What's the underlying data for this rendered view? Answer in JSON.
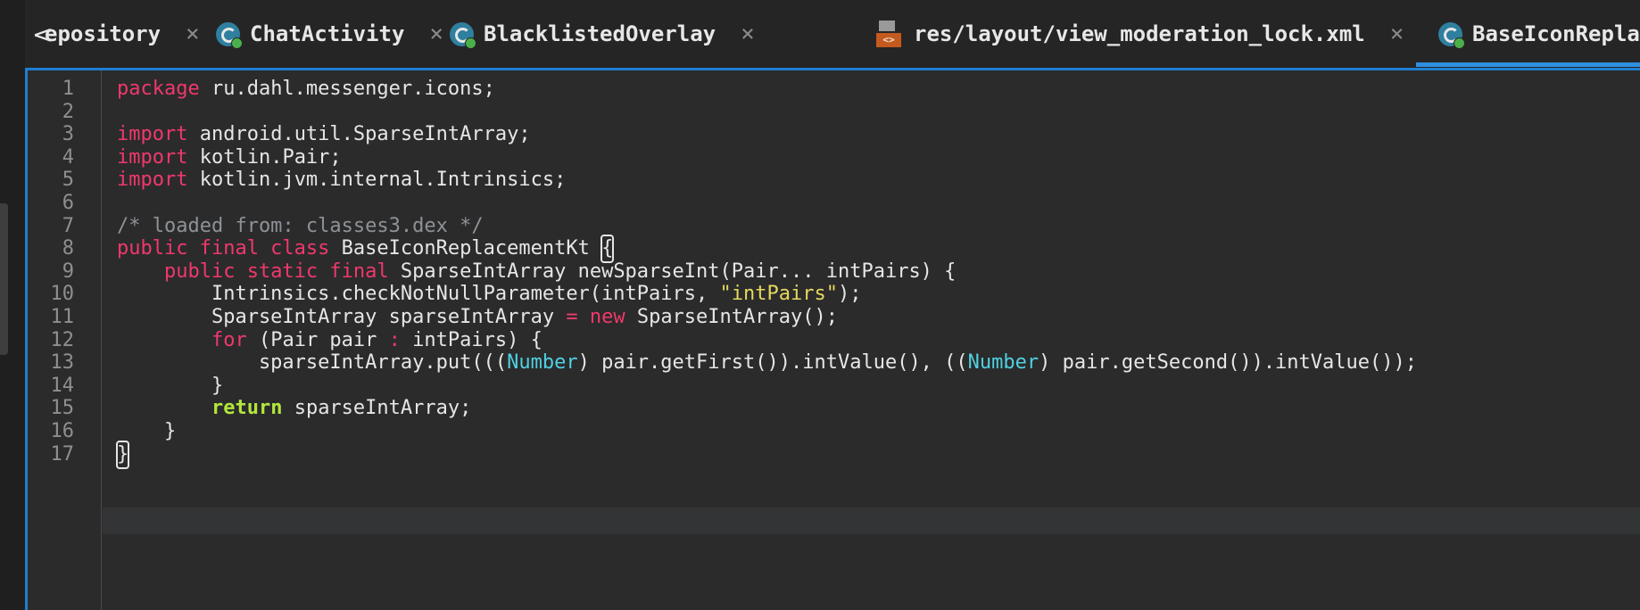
{
  "tabs": [
    {
      "label": "epository",
      "icon": "none",
      "close": "×",
      "left": 0
    },
    {
      "label": "ChatActivity",
      "icon": "class-icon",
      "close": "×"
    },
    {
      "label": "BlacklistedOverlay",
      "icon": "class-icon",
      "close": "×"
    },
    {
      "label": "res/layout/view_moderation_lock.xml",
      "icon": "xml-file-icon",
      "close": "×"
    },
    {
      "label": "BaseIconReplac",
      "icon": "class-icon",
      "active": true
    }
  ],
  "tab_nav": {
    "back": "<"
  },
  "xml_icon_text": "<>",
  "editor": {
    "line_numbers": [
      "1",
      "2",
      "3",
      "4",
      "5",
      "6",
      "7",
      "8",
      "9",
      "10",
      "11",
      "12",
      "13",
      "14",
      "15",
      "16",
      "17"
    ],
    "lines": [
      [
        {
          "t": "package",
          "c": "kw"
        },
        {
          "t": " ru.dahl.messenger.icons;",
          "c": ""
        }
      ],
      [],
      [
        {
          "t": "import",
          "c": "kw"
        },
        {
          "t": " android.util.SparseIntArray;",
          "c": ""
        }
      ],
      [
        {
          "t": "import",
          "c": "kw"
        },
        {
          "t": " kotlin.Pair;",
          "c": ""
        }
      ],
      [
        {
          "t": "import",
          "c": "kw"
        },
        {
          "t": " kotlin.jvm.internal.Intrinsics;",
          "c": ""
        }
      ],
      [],
      [
        {
          "t": "/* loaded from: classes3.dex */",
          "c": "cm"
        }
      ],
      [
        {
          "t": "public final class",
          "c": "kw"
        },
        {
          "t": " BaseIconReplacementKt ",
          "c": ""
        },
        {
          "t": "{",
          "c": "br"
        }
      ],
      [
        {
          "t": "    ",
          "c": ""
        },
        {
          "t": "public static final",
          "c": "kw"
        },
        {
          "t": " SparseIntArray newSparseInt(Pair... intPairs) {",
          "c": ""
        }
      ],
      [
        {
          "t": "        Intrinsics.checkNotNullParameter(intPairs, ",
          "c": ""
        },
        {
          "t": "\"intPairs\"",
          "c": "str"
        },
        {
          "t": ");",
          "c": ""
        }
      ],
      [
        {
          "t": "        SparseIntArray sparseIntArray ",
          "c": ""
        },
        {
          "t": "=",
          "c": "kw"
        },
        {
          "t": " ",
          "c": ""
        },
        {
          "t": "new",
          "c": "kw"
        },
        {
          "t": " SparseIntArray();",
          "c": ""
        }
      ],
      [
        {
          "t": "        ",
          "c": ""
        },
        {
          "t": "for",
          "c": "kw"
        },
        {
          "t": " (Pair pair ",
          "c": ""
        },
        {
          "t": ":",
          "c": "kw"
        },
        {
          "t": " intPairs) {",
          "c": ""
        }
      ],
      [
        {
          "t": "            sparseIntArray.put(((",
          "c": ""
        },
        {
          "t": "Number",
          "c": "ty"
        },
        {
          "t": ") pair.getFirst()).intValue(), ((",
          "c": ""
        },
        {
          "t": "Number",
          "c": "ty"
        },
        {
          "t": ") pair.getSecond()).intValue());",
          "c": ""
        }
      ],
      [
        {
          "t": "        }",
          "c": ""
        }
      ],
      [
        {
          "t": "        ",
          "c": ""
        },
        {
          "t": "return",
          "c": "kw2"
        },
        {
          "t": " sparseIntArray;",
          "c": ""
        }
      ],
      [
        {
          "t": "    }",
          "c": ""
        }
      ],
      [
        {
          "t": "}",
          "c": "br"
        }
      ]
    ]
  },
  "colors": {
    "accent": "#1e7fd0",
    "keyword": "#f0386b",
    "return_keyword": "#b3e63d",
    "type": "#4fd1e0",
    "string": "#e6d85c",
    "comment": "#8e9296"
  }
}
